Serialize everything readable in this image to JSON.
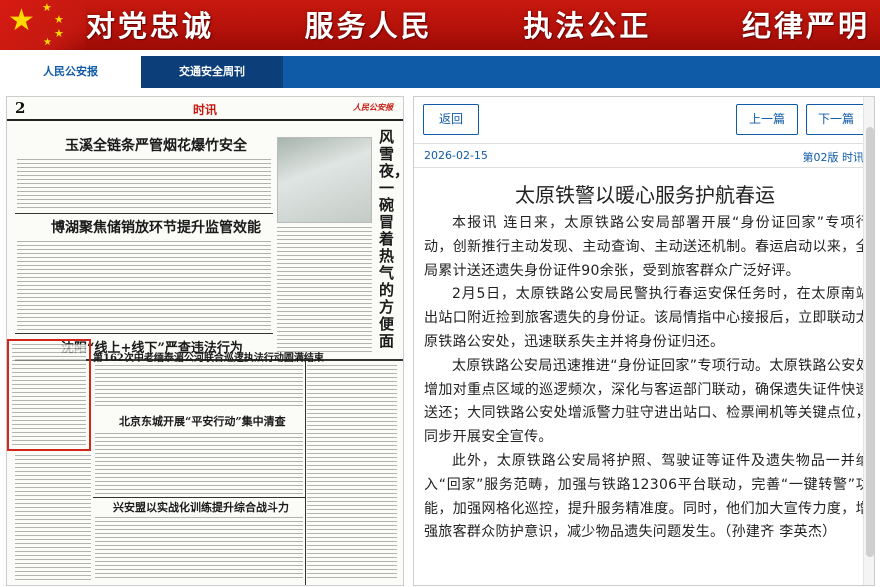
{
  "banner": {
    "slogans": [
      "对党忠诚",
      "服务人民",
      "执法公正",
      "纪律严明"
    ],
    "colors": {
      "red": "#c8190f",
      "star": "#ffd800"
    }
  },
  "tabs": [
    {
      "label": "人民公安报",
      "active": true
    },
    {
      "label": "交通安全周刊",
      "active": false
    }
  ],
  "newspaper": {
    "page_number": "2",
    "section": "时讯",
    "brand": "人民公安报",
    "headlines": [
      "玉溪全链条严管烟花爆竹安全",
      "博湖聚焦储销放环节提升监管效能",
      "沈阳“线上+线下”严查违法行为",
      "第162次中老缅泰湄公河联合巡逻执法行动圆满结束",
      "北京东城开展“平安行动”集中清查",
      "兴安盟以实战化训练提升综合战斗力"
    ],
    "vertical_title": "风雪夜，一碗冒着热气的方便面"
  },
  "article": {
    "back_label": "返回",
    "prev_label": "上一篇",
    "next_label": "下一篇",
    "date": "2026-02-15",
    "edition": "第02版 时讯",
    "title": "太原铁警以暖心服务护航春运",
    "paragraphs": [
      "本报讯 连日来，太原铁路公安局部署开展“身份证回家”专项行动，创新推行主动发现、主动查询、主动送还机制。春运启动以来，全局累计送还遗失身份证件90余张，受到旅客群众广泛好评。",
      "2月5日，太原铁路公安局民警执行春运安保任务时，在太原南站出站口附近捡到旅客遗失的身份证。该局情指中心接报后，立即联动太原铁路公安处，迅速联系失主并将身份证归还。",
      "太原铁路公安局迅速推进“身份证回家”专项行动。太原铁路公安处增加对重点区域的巡逻频次，深化与客运部门联动，确保遗失证件快速送还；大同铁路公安处增派警力驻守进出站口、检票闸机等关键点位，同步开展安全宣传。",
      "此外，太原铁路公安局将护照、驾驶证等证件及遗失物品一并纳入“回家”服务范畴，加强与铁路12306平台联动，完善“一键转警”功能，加强网格化巡控，提升服务精准度。同时，他们加大宣传力度，增强旅客群众防护意识，减少物品遗失问题发生。（孙建齐 李英杰）"
    ]
  }
}
